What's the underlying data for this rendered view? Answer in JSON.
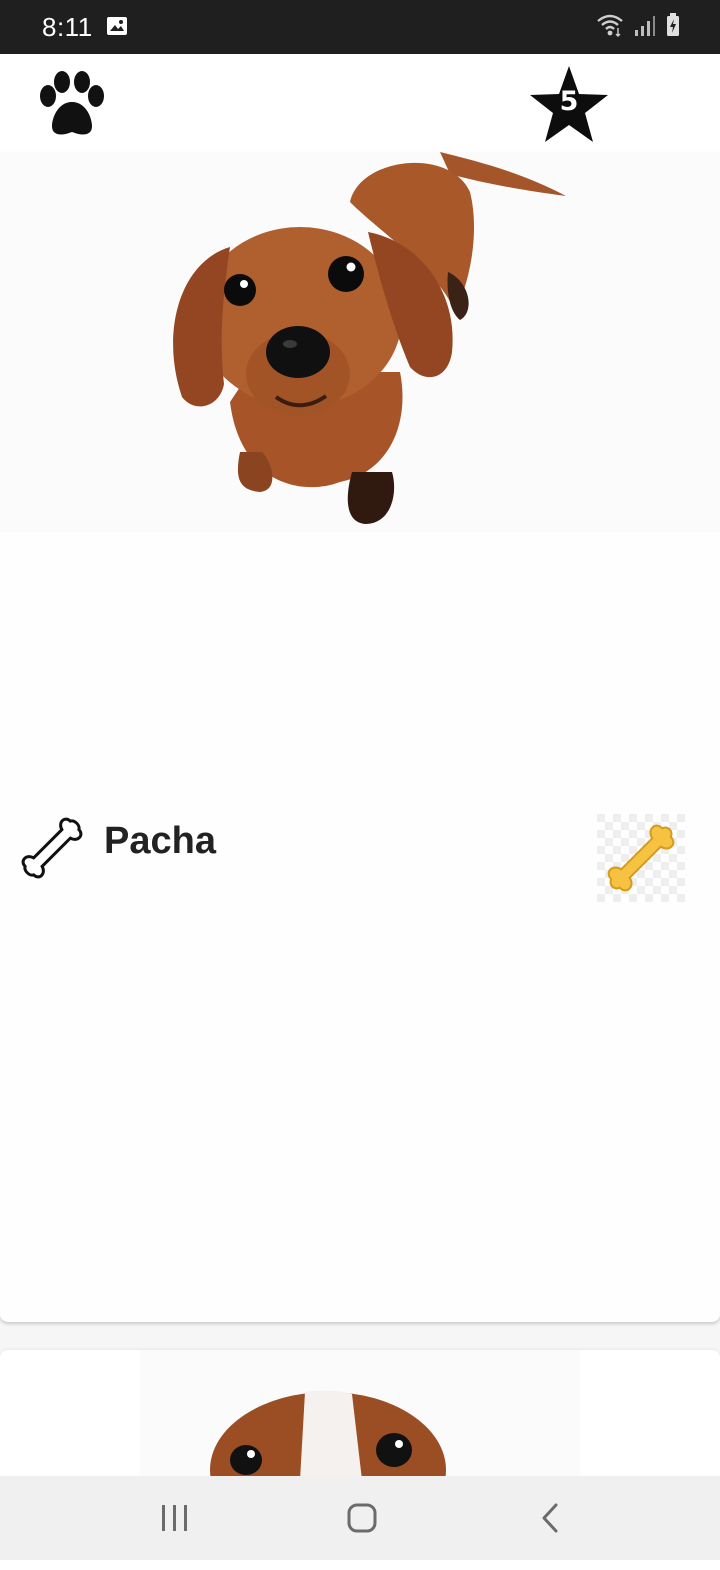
{
  "status_bar": {
    "time": "8:11",
    "icons": [
      "gallery-icon",
      "wifi-icon",
      "signal-icon",
      "battery-charging-icon"
    ]
  },
  "app_bar": {
    "logo_icon": "paw-icon",
    "score_icon": "star-icon",
    "score": "5"
  },
  "cards": [
    {
      "name": "Pacha",
      "photo": "dachshund-puppy",
      "left_icon": "bone-outline-icon",
      "action_icon": "bone-icon"
    },
    {
      "photo": "beagle-puppy"
    }
  ],
  "nav_bar": {
    "items": [
      "recents-icon",
      "home-icon",
      "back-icon"
    ]
  },
  "colors": {
    "status_bar_bg": "#1f1f1f",
    "app_bar_bg": "#ffffff",
    "page_bg": "#f6f6f6",
    "bone_yellow": "#f5c242",
    "dog_brown": "#a9582a"
  }
}
